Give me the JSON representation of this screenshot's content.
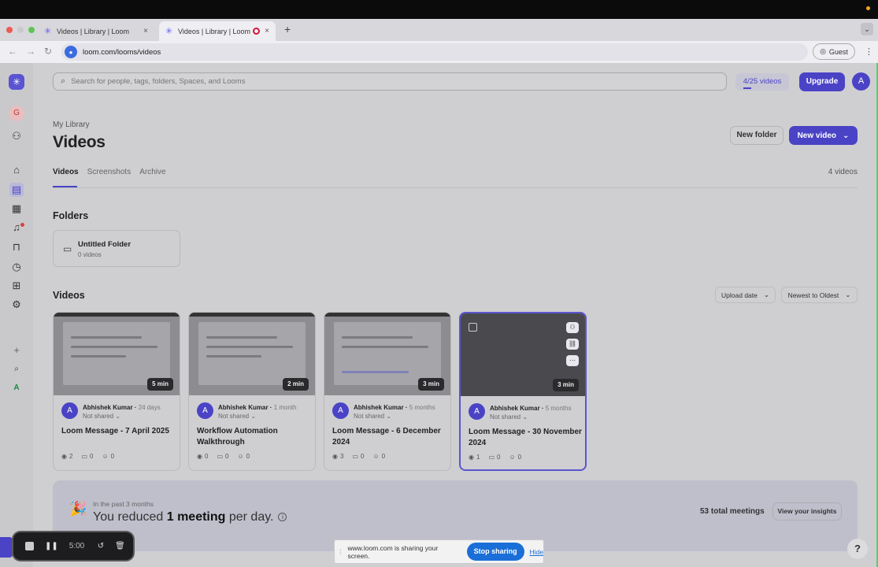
{
  "browser": {
    "tabs": [
      {
        "title": "Videos | Library | Loom",
        "recording": false
      },
      {
        "title": "Videos | Library | Loom",
        "recording": true
      }
    ],
    "url": "loom.com/looms/videos",
    "profile": "Guest"
  },
  "topbar": {
    "search_placeholder": "Search for people, tags, folders, Spaces, and Looms",
    "quota": "4/25 videos",
    "upgrade": "Upgrade",
    "avatar_letter": "A"
  },
  "sidebar": {
    "workspace_letter": "G",
    "user_letter": "A"
  },
  "library": {
    "breadcrumb": "My Library",
    "title": "Videos",
    "new_folder": "New folder",
    "new_video": "New video",
    "tabs": [
      "Videos",
      "Screenshots",
      "Archive"
    ],
    "video_count": "4 videos",
    "folders_title": "Folders",
    "folder": {
      "name": "Untitled Folder",
      "sub": "0 videos"
    },
    "videos_title": "Videos",
    "sort_field": "Upload date",
    "sort_order": "Newest to Oldest"
  },
  "videos": [
    {
      "duration": "5 min",
      "author": "Abhishek Kumar",
      "ago": "24 days",
      "shared": "Not shared",
      "title": "Loom Message - 7 April 2025",
      "views": "2",
      "comments": "0",
      "reactions": "0"
    },
    {
      "duration": "2 min",
      "author": "Abhishek Kumar",
      "ago": "1 month",
      "shared": "Not shared",
      "title": "Workflow Automation Walkthrough",
      "views": "0",
      "comments": "0",
      "reactions": "0"
    },
    {
      "duration": "3 min",
      "author": "Abhishek Kumar",
      "ago": "5 months",
      "shared": "Not shared",
      "title": "Loom Message - 6 December 2024",
      "views": "3",
      "comments": "0",
      "reactions": "0"
    },
    {
      "duration": "3 min",
      "author": "Abhishek Kumar",
      "ago": "5 months",
      "shared": "Not shared",
      "title": "Loom Message - 30 November 2024",
      "views": "1",
      "comments": "0",
      "reactions": "0"
    }
  ],
  "insights": {
    "period": "In the past 3 months",
    "text_before": "You reduced ",
    "text_bold": "1 meeting",
    "text_after": " per day.",
    "total": "53 total meetings",
    "cta": "View your insights"
  },
  "recorder": {
    "time": "5:00"
  },
  "share_banner": {
    "message": "www.loom.com is sharing your screen.",
    "stop": "Stop sharing",
    "hide": "Hide"
  }
}
